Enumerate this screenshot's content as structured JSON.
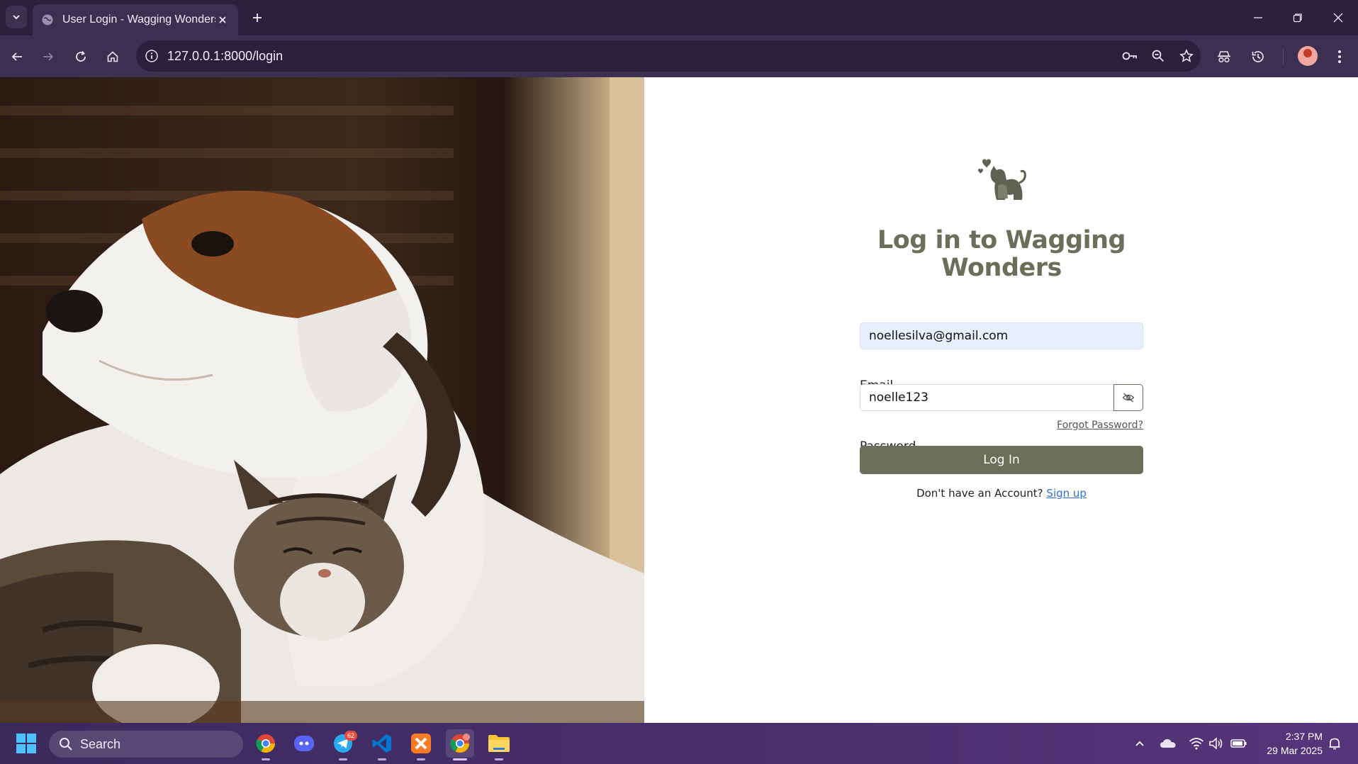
{
  "browser": {
    "tab_title": "User Login - Wagging Wonders",
    "url": "127.0.0.1:8000/login"
  },
  "login": {
    "heading": "Log in to Wagging Wonders",
    "email_label": "Email",
    "email_value": "noellesilva@gmail.com",
    "password_label": "Password",
    "password_value": "noelle123",
    "forgot_link": "Forgot Password?",
    "login_button": "Log In",
    "signup_prompt": "Don't have an Account?",
    "signup_link": "Sign up"
  },
  "taskbar": {
    "search_placeholder": "Search",
    "telegram_badge": "62",
    "time": "2:37 PM",
    "date": "29 Mar 2025"
  },
  "colors": {
    "accent": "#6b6e58",
    "chrome_dark": "#2a1f3d",
    "chrome_toolbar": "#3b2f52",
    "link": "#2f6fd6"
  }
}
